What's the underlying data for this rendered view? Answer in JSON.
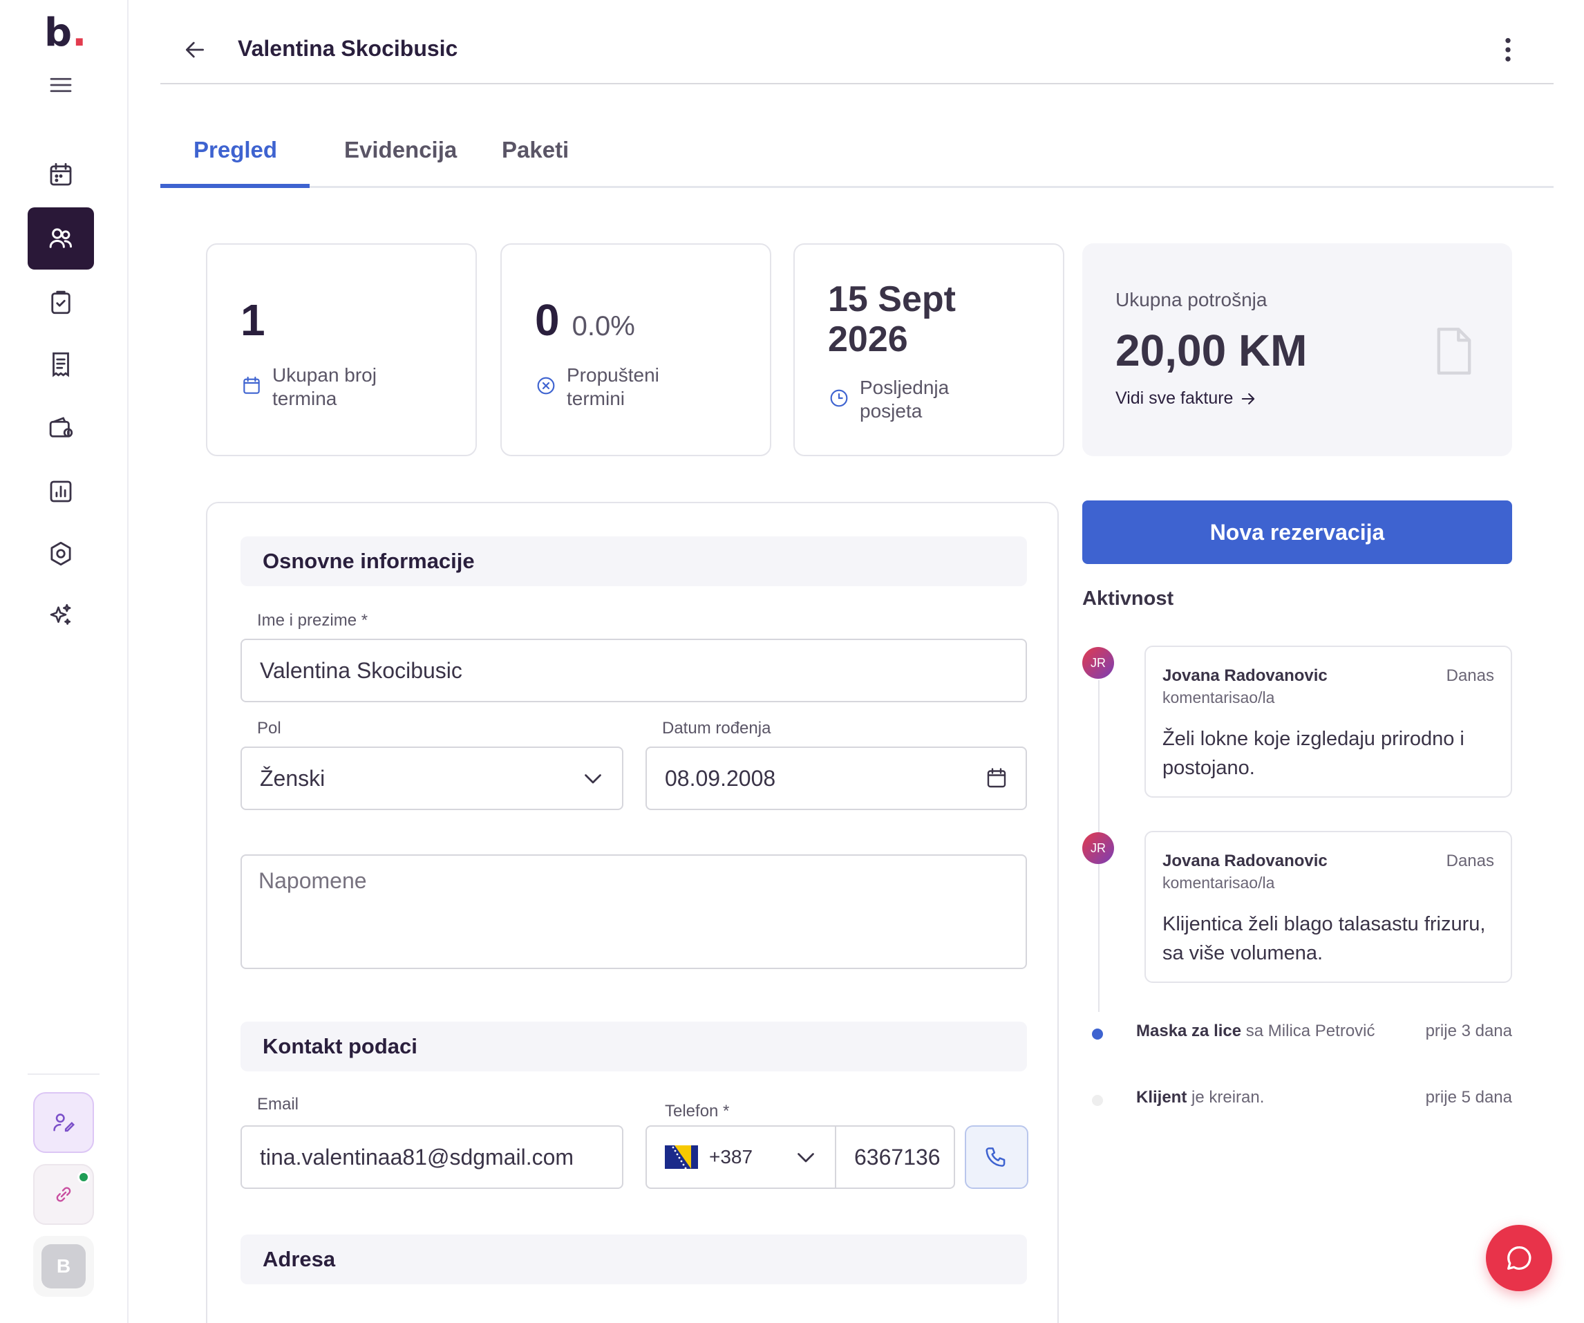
{
  "brand": {
    "logo_letter": "b",
    "logo_dot": "."
  },
  "sidebar": {
    "items": [
      {
        "name": "calendar-icon"
      },
      {
        "name": "clients-icon",
        "active": true
      },
      {
        "name": "clipboard-check-icon"
      },
      {
        "name": "receipt-icon"
      },
      {
        "name": "wallet-icon"
      },
      {
        "name": "chart-icon"
      },
      {
        "name": "settings-icon"
      },
      {
        "name": "sparkles-icon"
      }
    ],
    "user_initial": "B"
  },
  "header": {
    "title": "Valentina Skocibusic"
  },
  "tabs": [
    {
      "label": "Pregled",
      "active": true
    },
    {
      "label": "Evidencija"
    },
    {
      "label": "Paketi"
    }
  ],
  "stats": {
    "total": {
      "value": "1",
      "label": "Ukupan broj termina"
    },
    "missed": {
      "value": "0",
      "percent": "0.0%",
      "label": "Propušteni termini"
    },
    "last_visit": {
      "value": "15 Sept 2026",
      "label": "Posljednja posjeta"
    }
  },
  "spending": {
    "label": "Ukupna potrošnja",
    "value": "20,00 KM",
    "link": "Vidi sve fakture"
  },
  "form": {
    "basic_section": "Osnovne informacije",
    "name_label": "Ime i prezime *",
    "name_value": "Valentina Skocibusic",
    "gender_label": "Pol",
    "gender_value": "Ženski",
    "dob_label": "Datum rođenja",
    "dob_value": "08.09.2008",
    "notes_placeholder": "Napomene",
    "contact_section": "Kontakt podaci",
    "email_label": "Email",
    "email_value": "tina.valentinaa81@sdgmail.com",
    "phone_label": "Telefon *",
    "phone_prefix": "+387",
    "phone_value": "6367136",
    "address_section": "Adresa"
  },
  "actions": {
    "new_reservation": "Nova rezervacija"
  },
  "activity": {
    "title": "Aktivnost",
    "comments": [
      {
        "initials": "JR",
        "author": "Jovana Radovanovic",
        "action": "komentarisao/la",
        "time": "Danas",
        "text": "Želi lokne koje izgledaju prirodno i postojano."
      },
      {
        "initials": "JR",
        "author": "Jovana Radovanovic",
        "action": "komentarisao/la",
        "time": "Danas",
        "text": "Klijentica želi blago talasastu frizuru, sa više volumena."
      }
    ],
    "events": [
      {
        "bold": "Maska za lice",
        "rest": " sa Milica Petrović",
        "time": "prije 3 dana",
        "color": "#3e63d0"
      },
      {
        "bold": "Klijent",
        "rest": " je kreiran.",
        "time": "prije 5 dana",
        "color": "#eeeeee"
      }
    ]
  },
  "colors": {
    "primary": "#3e63d0",
    "dark": "#2a1838",
    "accent": "#e8334a"
  }
}
